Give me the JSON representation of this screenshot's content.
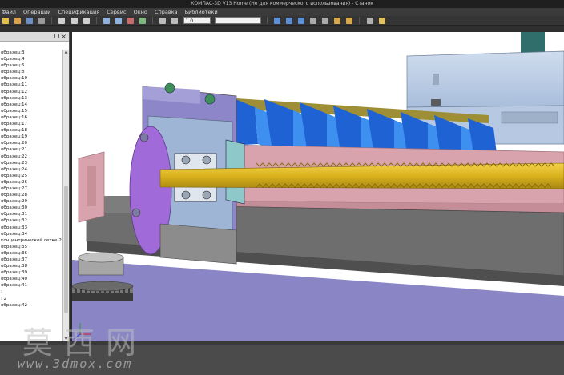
{
  "window": {
    "title": "КОМПАС-3D V13 Home (Не для коммерческого использования) - Станок"
  },
  "menu": {
    "items": [
      "Файл",
      "Операции",
      "Спецификация",
      "Сервис",
      "Окно",
      "Справка",
      "Библиотеки"
    ]
  },
  "toolbar": {
    "scale_value": "1.0"
  },
  "tree": {
    "items": [
      "образец:3",
      "образец:4",
      "образец:5",
      "образец:8",
      "образец:10",
      "образец:11",
      "образец:12",
      "образец:13",
      "образец:14",
      "образец:15",
      "образец:16",
      "образец:17",
      "образец:18",
      "образец:19",
      "образец:20",
      "образец:21",
      "образец:22",
      "образец:23",
      "образец:24",
      "образец:25",
      "образец:26",
      "образец:27",
      "образец:28",
      "образец:29",
      "образец:30",
      "образец:31",
      "образец:32",
      "образец:33",
      "образец:34",
      "концентрической сетке:2",
      "образец:35",
      "образец:36",
      "образец:37",
      "образец:38",
      "образец:39",
      "образец:40",
      "образец:41",
      ":",
      ": 2",
      "образец:42"
    ]
  },
  "watermark": {
    "cn": "莫西网",
    "url": "www.3dmox.com"
  },
  "colors": {
    "bellows_blue": "#2f7fe8",
    "screw_yellow": "#d9b21d",
    "rail_pink": "#d9a3ad",
    "frame_purple": "#8d86c9",
    "base_grey": "#6e6e6e",
    "table_light_blue": "#b8cde6"
  }
}
